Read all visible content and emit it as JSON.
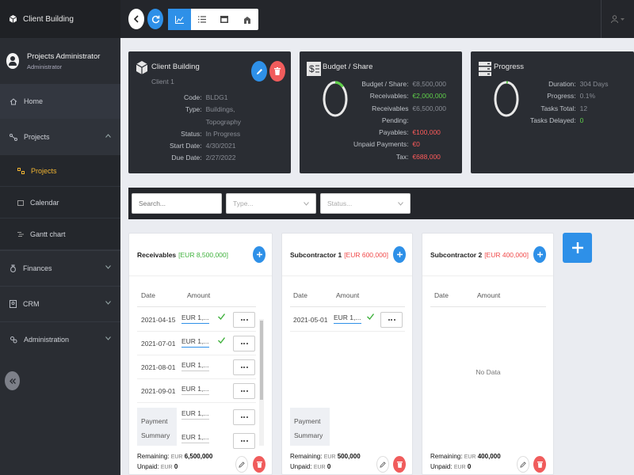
{
  "brand": {
    "title": "Client Building",
    "icon": "cube-icon"
  },
  "user": {
    "name": "Projects Administrator",
    "role": "Administrator"
  },
  "nav": {
    "home": "Home",
    "projects": "Projects",
    "projects_sub": [
      "Projects",
      "Calendar",
      "Gantt chart"
    ],
    "finances": "Finances",
    "crm": "CRM",
    "administration": "Administration"
  },
  "project_card": {
    "title": "Client Building",
    "subtitle": "Client 1",
    "fields": [
      {
        "k": "Code:",
        "v": "BLDG1"
      },
      {
        "k": "Type:",
        "v": "Buildings,"
      },
      {
        "k": "",
        "v": "Topography"
      },
      {
        "k": "Status:",
        "v": "In Progress"
      },
      {
        "k": "Start Date:",
        "v": "4/30/2021"
      },
      {
        "k": "Due Date:",
        "v": "2/27/2022"
      }
    ]
  },
  "budget_card": {
    "title": "Budget / Share",
    "progress_fraction": 0.12,
    "fields": [
      {
        "k": "Budget / Share:",
        "v": "€8,500,000"
      },
      {
        "k": "Receivables:",
        "v": "€2,000,000"
      },
      {
        "k": "Receivables",
        "v": "€6,500,000"
      },
      {
        "k": "Pending:",
        "v": ""
      },
      {
        "k": "Payables:",
        "v": "€100,000"
      },
      {
        "k": "Unpaid Payments:",
        "v": "€0"
      },
      {
        "k": "Tax:",
        "v": "€688,000"
      }
    ]
  },
  "progress_card": {
    "title": "Progress",
    "progress_fraction": 0.001,
    "fields": [
      {
        "k": "Duration:",
        "v": "304 Days"
      },
      {
        "k": "Progress:",
        "v": "0.1%"
      },
      {
        "k": "Tasks Total:",
        "v": "12"
      },
      {
        "k": "Tasks Delayed:",
        "v": "0"
      }
    ]
  },
  "filters": {
    "search": "Search...",
    "type": "Type...",
    "status": "Status..."
  },
  "lists": [
    {
      "title": "Receivables",
      "tag": "[EUR 8,500,000]",
      "col_date": "Date",
      "col_amount": "Amount",
      "rows": [
        {
          "date": "2021-04-15",
          "amount": "EUR  1,...",
          "checked": true
        },
        {
          "date": "2021-07-01",
          "amount": "EUR  1,...",
          "checked": true
        },
        {
          "date": "2021-08-01",
          "amount": "EUR  1,...",
          "checked": false
        },
        {
          "date": "2021-09-01",
          "amount": "EUR  1,...",
          "checked": false
        }
      ],
      "summary": [
        "Payment",
        "Summary"
      ],
      "summary_amounts": [
        "EUR  1,...",
        "EUR  1,..."
      ],
      "remaining_label": "Remaining:",
      "remaining_cur": "EUR",
      "remaining": "6,500,000",
      "unpaid_label": "Unpaid:",
      "unpaid_cur": "EUR",
      "unpaid": "0"
    },
    {
      "title": "Subcontractor 1",
      "tag": "[EUR 600,000]",
      "col_date": "Date",
      "col_amount": "Amount",
      "rows": [
        {
          "date": "2021-05-01",
          "amount": "EUR  1,...",
          "checked": true
        }
      ],
      "summary": [
        "Payment",
        "Summary"
      ],
      "remaining_label": "Remaining:",
      "remaining_cur": "EUR",
      "remaining": "500,000",
      "unpaid_label": "Unpaid:",
      "unpaid_cur": "EUR",
      "unpaid": "0"
    },
    {
      "title": "Subcontractor 2",
      "tag": "[EUR 400,000]",
      "col_date": "Date",
      "col_amount": "Amount",
      "rows": [],
      "no_data": "No Data",
      "remaining_label": "Remaining:",
      "remaining_cur": "EUR",
      "remaining": "400,000",
      "unpaid_label": "Unpaid:",
      "unpaid_cur": "EUR",
      "unpaid": "0"
    }
  ],
  "colors": {
    "accent": "#2e90e8",
    "sidebar": "#2a2d33",
    "success": "#5fcf4a",
    "danger": "#ff5b5b",
    "active_nav": "#f0b432"
  }
}
